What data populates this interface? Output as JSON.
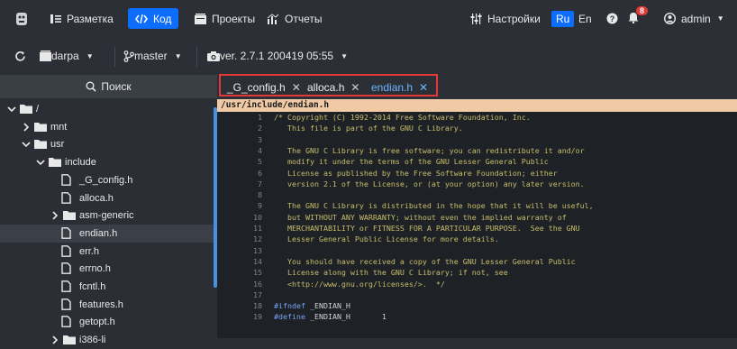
{
  "topbar": {
    "markup": "Разметка",
    "code": "Код",
    "projects": "Проекты",
    "reports": "Отчеты",
    "settings": "Настройки",
    "lang_ru": "Ru",
    "lang_en": "En",
    "notification_count": "8",
    "user": "admin"
  },
  "subbar": {
    "project": "darpa",
    "branch": "master",
    "version": "ver. 2.7.1 200419 05:55"
  },
  "sidebar": {
    "search": "Поиск",
    "tree": [
      {
        "label": "/",
        "kind": "folder",
        "indent": 0,
        "arrow": "down"
      },
      {
        "label": "mnt",
        "kind": "folder",
        "indent": 1,
        "arrow": "right"
      },
      {
        "label": "usr",
        "kind": "folder",
        "indent": 1,
        "arrow": "down"
      },
      {
        "label": "include",
        "kind": "folder",
        "indent": 2,
        "arrow": "down"
      },
      {
        "label": "_G_config.h",
        "kind": "file",
        "indent": 3
      },
      {
        "label": "alloca.h",
        "kind": "file",
        "indent": 3
      },
      {
        "label": "asm-generic",
        "kind": "folder",
        "indent": 3,
        "arrow": "right"
      },
      {
        "label": "endian.h",
        "kind": "file",
        "indent": 3,
        "selected": true
      },
      {
        "label": "err.h",
        "kind": "file",
        "indent": 3
      },
      {
        "label": "errno.h",
        "kind": "file",
        "indent": 3
      },
      {
        "label": "fcntl.h",
        "kind": "file",
        "indent": 3
      },
      {
        "label": "features.h",
        "kind": "file",
        "indent": 3
      },
      {
        "label": "getopt.h",
        "kind": "file",
        "indent": 3
      },
      {
        "label": "i386-li",
        "kind": "folder",
        "indent": 3,
        "arrow": "right"
      }
    ]
  },
  "editor": {
    "tabs": [
      {
        "label": "_G_config.h",
        "active": false
      },
      {
        "label": "alloca.h",
        "active": false
      },
      {
        "label": "endian.h",
        "active": true
      }
    ],
    "tab_close": "✕",
    "path": "/usr/include/endian.h",
    "lines": [
      {
        "n": "1",
        "t": "/* Copyright (C) 1992-2014 Free Software Foundation, Inc.",
        "c": "comment"
      },
      {
        "n": "2",
        "t": "   This file is part of the GNU C Library.",
        "c": "comment"
      },
      {
        "n": "3",
        "t": "",
        "c": "comment"
      },
      {
        "n": "4",
        "t": "   The GNU C Library is free software; you can redistribute it and/or",
        "c": "comment"
      },
      {
        "n": "5",
        "t": "   modify it under the terms of the GNU Lesser General Public",
        "c": "comment"
      },
      {
        "n": "6",
        "t": "   License as published by the Free Software Foundation; either",
        "c": "comment"
      },
      {
        "n": "7",
        "t": "   version 2.1 of the License, or (at your option) any later version.",
        "c": "comment"
      },
      {
        "n": "8",
        "t": "",
        "c": "comment"
      },
      {
        "n": "9",
        "t": "   The GNU C Library is distributed in the hope that it will be useful,",
        "c": "comment"
      },
      {
        "n": "10",
        "t": "   but WITHOUT ANY WARRANTY; without even the implied warranty of",
        "c": "comment"
      },
      {
        "n": "11",
        "t": "   MERCHANTABILITY or FITNESS FOR A PARTICULAR PURPOSE.  See the GNU",
        "c": "comment"
      },
      {
        "n": "12",
        "t": "   Lesser General Public License for more details.",
        "c": "comment"
      },
      {
        "n": "13",
        "t": "",
        "c": "comment"
      },
      {
        "n": "14",
        "t": "   You should have received a copy of the GNU Lesser General Public",
        "c": "comment"
      },
      {
        "n": "15",
        "t": "   License along with the GNU C Library; if not, see",
        "c": "comment"
      },
      {
        "n": "16",
        "t": "   <http://www.gnu.org/licenses/>.  */",
        "c": "comment"
      },
      {
        "n": "17",
        "t": "",
        "c": "plain"
      },
      {
        "n": "18",
        "kw": "#ifndef",
        "rest": "\t_ENDIAN_H"
      },
      {
        "n": "19",
        "kw": "#define",
        "rest": "\t_ENDIAN_H\t1"
      }
    ]
  },
  "colors": {
    "accent": "#0d6efd",
    "highlight_box": "#e53935",
    "path_bar": "#f0c9a5",
    "comment": "#c9bd6a"
  }
}
